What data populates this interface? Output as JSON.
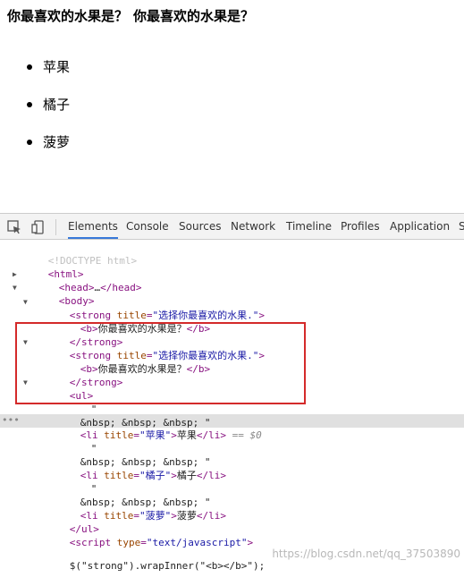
{
  "page": {
    "heading_1": "你最喜欢的水果是？",
    "heading_2": "你最喜欢的水果是？",
    "fruits": [
      "苹果",
      "橘子",
      "菠萝"
    ]
  },
  "devtools": {
    "tabs": [
      "Elements",
      "Console",
      "Sources",
      "Network",
      "Timeline",
      "Profiles",
      "Application",
      "S"
    ],
    "active_tab": "Elements",
    "source": {
      "doctype": "<!DOCTYPE html>",
      "html_open": "<html>",
      "head_tag_open": "<head>",
      "head_ellipsis": "…",
      "head_tag_close": "</head>",
      "body_open": "<body>",
      "strong_tag": "strong",
      "title_attr": "title",
      "strong_title_value": "\"选择你最喜欢的水果.\"",
      "b_open": "<b>",
      "b_text": "你最喜欢的水果是？",
      "b_close": "</b>",
      "strong_close": "</strong>",
      "ul_open": "<ul>",
      "quote": "\"",
      "nbsp_line": "&nbsp; &nbsp; &nbsp; \"",
      "li_tag": "li",
      "li_close": "</li>",
      "li_titles": [
        "\"苹果\"",
        "\"橘子\"",
        "\"菠萝\""
      ],
      "li_texts": [
        "苹果",
        "橘子",
        "菠萝"
      ],
      "selected_marker": "== $0",
      "ul_close": "</ul>",
      "script_tag": "script",
      "type_attr": "type",
      "script_type_value": "\"text/javascript\"",
      "script_code": "$(\"strong\").wrapInner(\"<b></b>\");"
    }
  },
  "watermark": "https://blog.csdn.net/qq_37503890",
  "colors": {
    "highlight_box": "#d42a2a",
    "tag": "#881280",
    "attr_name": "#994500",
    "attr_value": "#1a1aa6",
    "active_tab_underline": "#3879d9",
    "selected_row": "#e0e0e0"
  }
}
